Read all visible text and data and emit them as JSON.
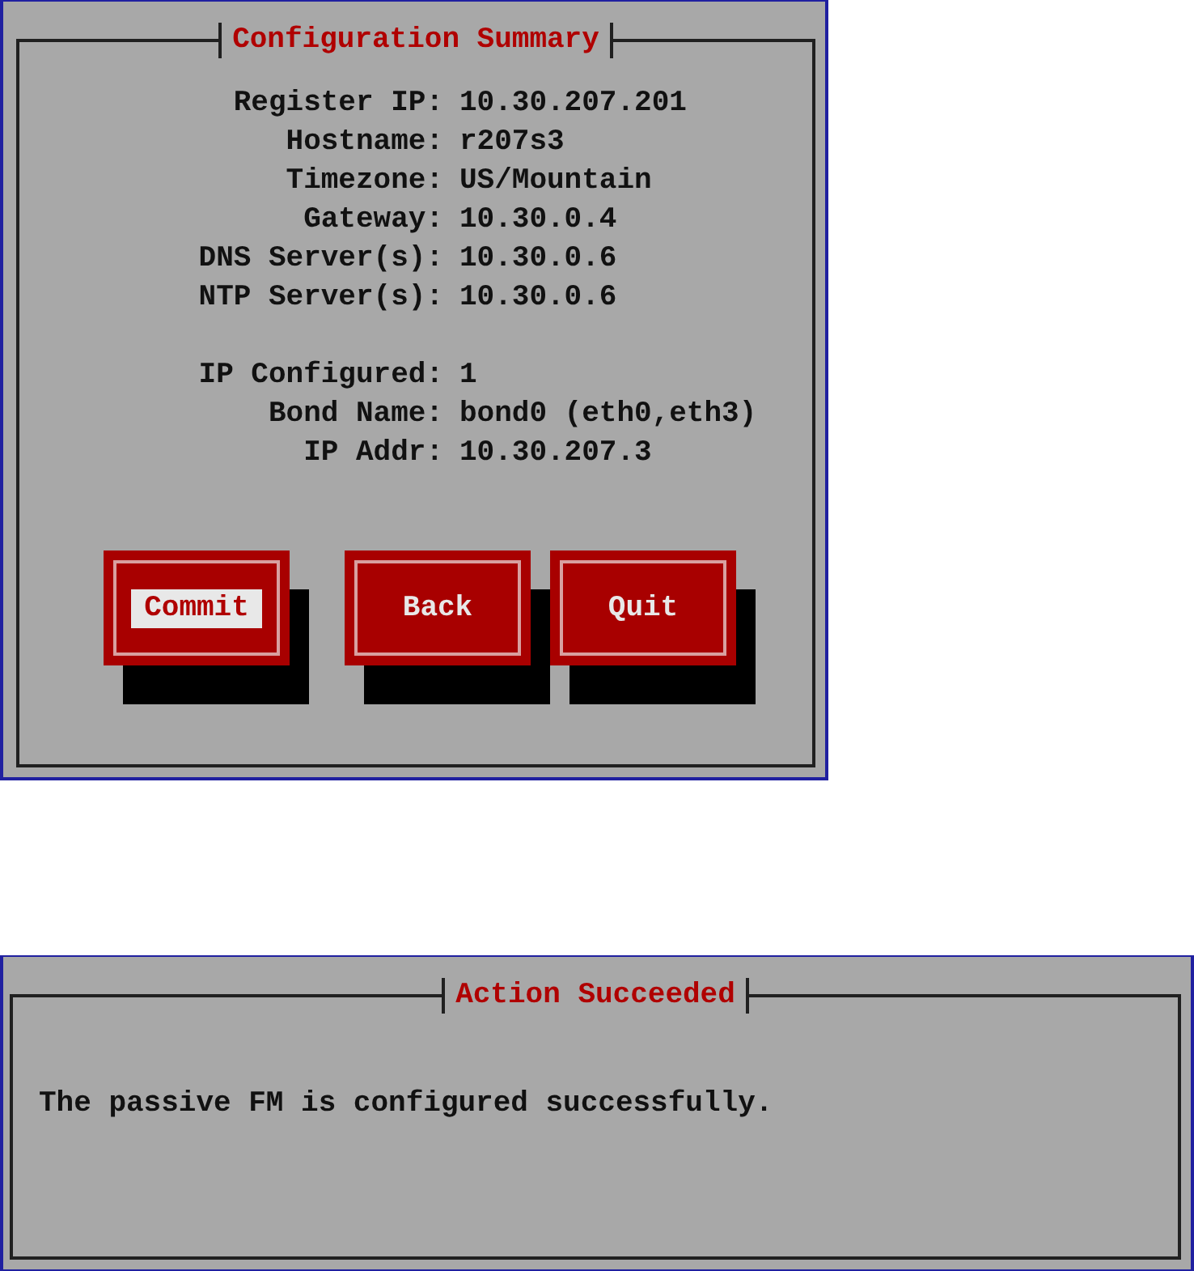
{
  "dialogs": [
    {
      "title": "Configuration Summary",
      "fields": [
        {
          "label": "Register IP:",
          "value": "10.30.207.201"
        },
        {
          "label": "Hostname:",
          "value": "r207s3"
        },
        {
          "label": "Timezone:",
          "value": "US/Mountain"
        },
        {
          "label": "Gateway:",
          "value": "10.30.0.4"
        },
        {
          "label": "DNS Server(s):",
          "value": "10.30.0.6"
        },
        {
          "label": "NTP Server(s):",
          "value": "10.30.0.6"
        }
      ],
      "interface_fields": [
        {
          "label": "IP Configured:",
          "value": "1"
        },
        {
          "label": "Bond Name:",
          "value": "bond0 (eth0,eth3)"
        },
        {
          "label": "IP Addr:",
          "value": "10.30.207.3"
        }
      ],
      "buttons": [
        {
          "label": "Commit",
          "selected": true
        },
        {
          "label": "Back",
          "selected": false
        },
        {
          "label": "Quit",
          "selected": false
        }
      ]
    },
    {
      "title": "Action Succeeded",
      "message": "The passive FM is configured successfully."
    }
  ]
}
